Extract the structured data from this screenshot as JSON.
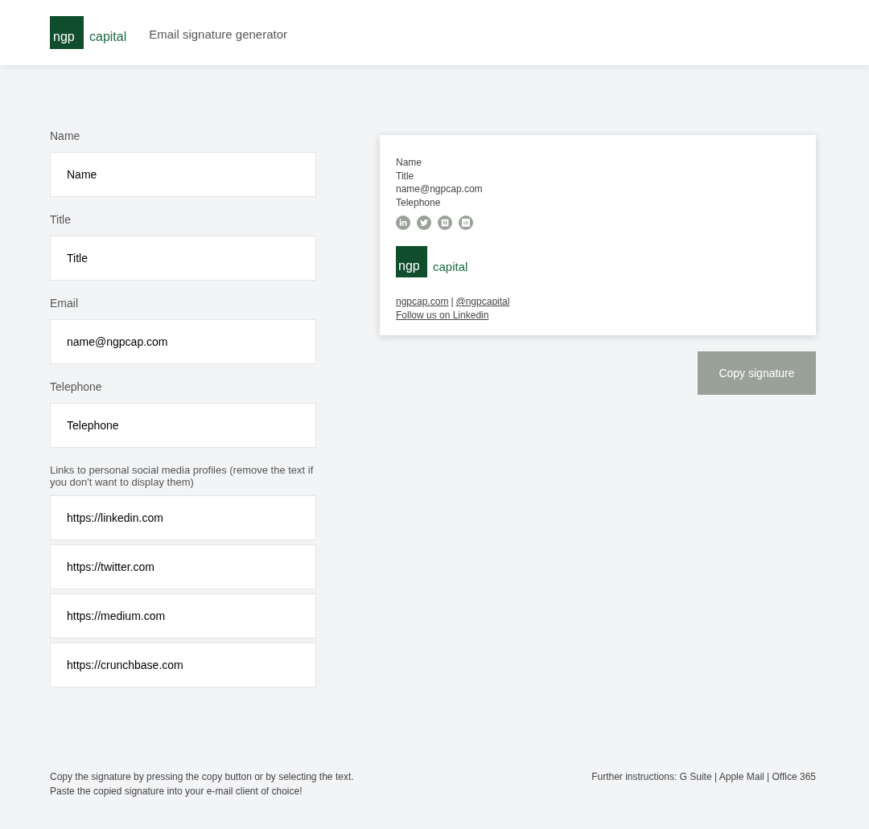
{
  "header": {
    "logo": {
      "mark": "ngp",
      "word": "capital"
    },
    "title": "Email signature generator"
  },
  "form": {
    "fields": [
      {
        "label": "Name",
        "value": "Name"
      },
      {
        "label": "Title",
        "value": "Title"
      },
      {
        "label": "Email",
        "value": "name@ngpcap.com"
      },
      {
        "label": "Telephone",
        "value": "Telephone"
      }
    ],
    "social_label": "Links to personal social media profiles (remove the text if you don't want to display them)",
    "social_fields": [
      {
        "value": "https://linkedin.com"
      },
      {
        "value": "https://twitter.com"
      },
      {
        "value": "https://medium.com"
      },
      {
        "value": "https://crunchbase.com"
      }
    ]
  },
  "preview": {
    "lines": [
      "Name",
      "Title",
      "name@ngpcap.com",
      "Telephone"
    ],
    "social_icons": [
      {
        "kind": "linkedin"
      },
      {
        "kind": "twitter"
      },
      {
        "kind": "medium"
      },
      {
        "kind": "crunchbase"
      }
    ],
    "logo": {
      "mark": "ngp",
      "word": "capital"
    },
    "website": "ngpcap.com",
    "separator": "|",
    "handle": "@ngpcapital",
    "follow": "Follow us on Linkedin"
  },
  "copy_button": "Copy signature",
  "footer": {
    "help": [
      "Copy the signature by pressing the copy button or by selecting the text.",
      "Paste the copied signature into your e-mail client of choice!"
    ],
    "instructions": "Further instructions: G Suite | Apple Mail | Office 365"
  }
}
